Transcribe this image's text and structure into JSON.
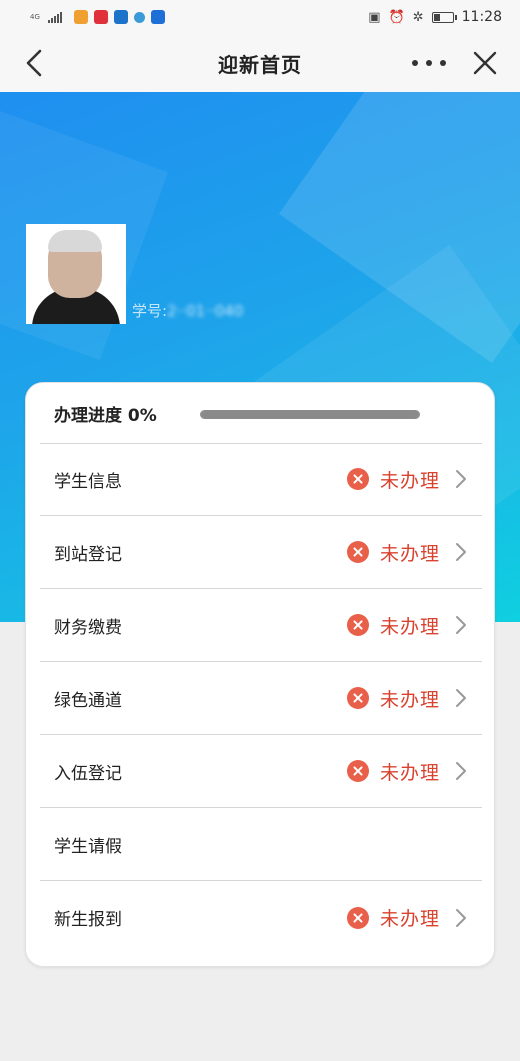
{
  "status_bar": {
    "network": "4G",
    "time": "11:28",
    "app_icons": [
      "#f0a030",
      "#e0303a",
      "#1d73c9",
      "#3a9bd8",
      "#1e6fd6"
    ]
  },
  "nav": {
    "title": "迎新首页"
  },
  "profile": {
    "name": "",
    "student_id_prefix": "学号:",
    "student_id": "2··01··040"
  },
  "progress": {
    "label": "办理进度 0%",
    "value_percent": 0
  },
  "tasks": [
    {
      "label": "学生信息",
      "status": "未办理"
    },
    {
      "label": "到站登记",
      "status": "未办理"
    },
    {
      "label": "财务缴费",
      "status": "未办理"
    },
    {
      "label": "绿色通道",
      "status": "未办理"
    },
    {
      "label": "入伍登记",
      "status": "未办理"
    },
    {
      "label": "学生请假"
    },
    {
      "label": "新生报到",
      "status": "未办理"
    }
  ],
  "colors": {
    "accent_blue": "#1e90f0",
    "status_red": "#d9422f",
    "x_icon_red": "#e8604a"
  }
}
